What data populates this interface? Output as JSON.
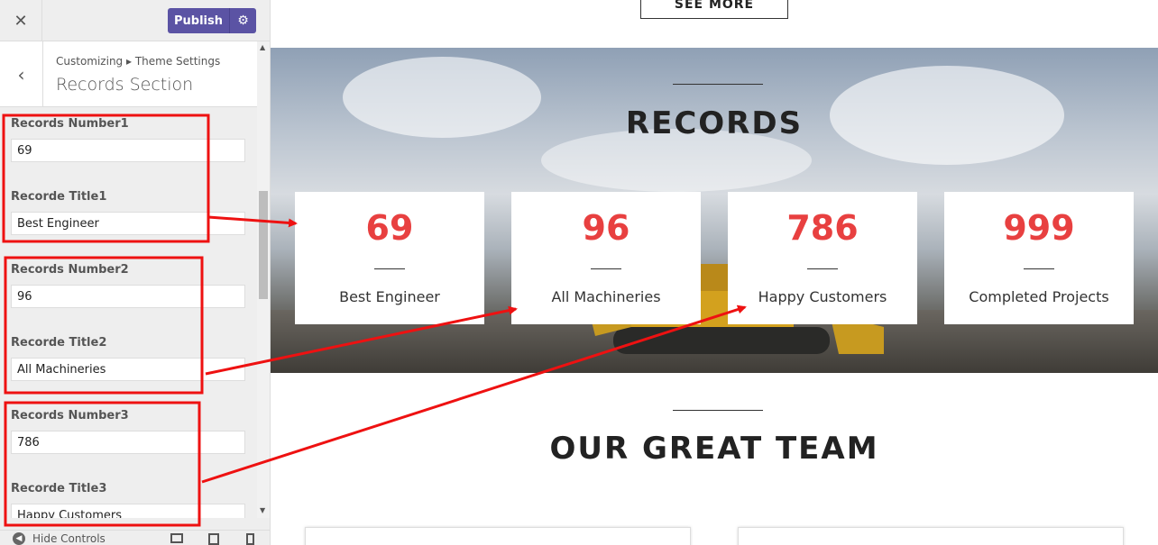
{
  "sidebar": {
    "close_icon": "close-icon",
    "publish_label": "Publish",
    "gear_icon": "gear-icon",
    "breadcrumb": "Customizing ▸ Theme Settings",
    "section_title": "Records Section",
    "fields": [
      {
        "label": "Records Number1",
        "value": "69"
      },
      {
        "label": "Recorde Title1",
        "value": "Best Engineer"
      },
      {
        "label": "Records Number2",
        "value": "96"
      },
      {
        "label": "Recorde Title2",
        "value": "All Machineries"
      },
      {
        "label": "Records Number3",
        "value": "786"
      },
      {
        "label": "Recorde Title3",
        "value": "Happy Customers"
      }
    ],
    "hide_controls": "Hide Controls"
  },
  "preview": {
    "see_more": "SEE MORE",
    "records_title": "RECORDS",
    "records": [
      {
        "number": "69",
        "title": "Best Engineer"
      },
      {
        "number": "96",
        "title": "All Machineries"
      },
      {
        "number": "786",
        "title": "Happy Customers"
      },
      {
        "number": "999",
        "title": "Completed Projects"
      }
    ],
    "team_title": "OUR GREAT TEAM"
  },
  "colors": {
    "accent": "#5b53a4",
    "record_number": "#e84040",
    "annotation": "#ee1111"
  }
}
